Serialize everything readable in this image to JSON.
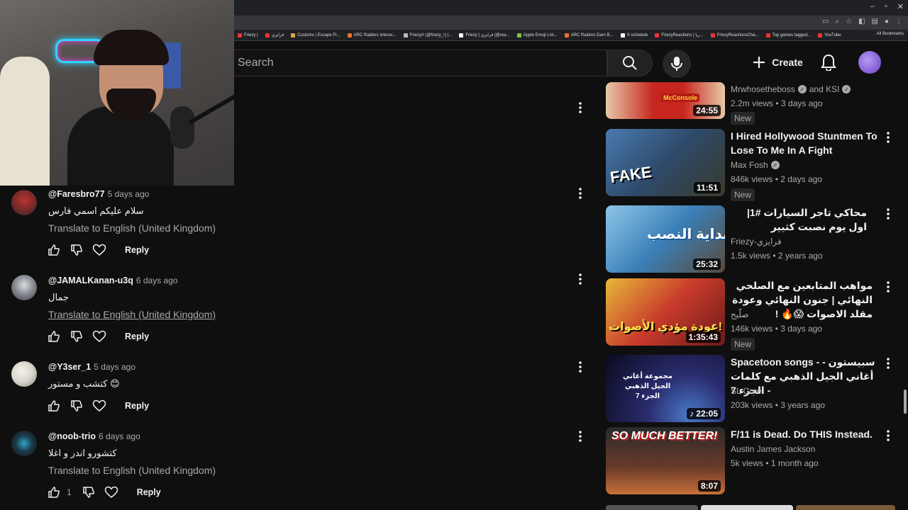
{
  "browser": {
    "bookmarks": [
      {
        "label": "Friezy |",
        "color": "#e33"
      },
      {
        "label": "فرايزي",
        "color": "#e33"
      },
      {
        "label": "Customs | Escape Fr...",
        "color": "#d9a441"
      },
      {
        "label": "ARC Raiders Interac...",
        "color": "#e8742c"
      },
      {
        "label": "Friezy/r (@friezy_r) |...",
        "color": "#bbb"
      },
      {
        "label": "Friezy | فرايزي (@rea...",
        "color": "#fff"
      },
      {
        "label": "Apple Emoji List...",
        "color": "#7cc04a"
      },
      {
        "label": "ARC Raiders Dam B...",
        "color": "#e8742c"
      },
      {
        "label": "X schedule",
        "color": "#fff"
      },
      {
        "label": "FriezyReactions | ريا...",
        "color": "#e33"
      },
      {
        "label": "FriezyReactionsCha...",
        "color": "#e33"
      },
      {
        "label": "Top games tagged...",
        "color": "#e33"
      },
      {
        "label": "YouTube",
        "color": "#e33"
      }
    ],
    "all_bookmarks": "All Bookmarks"
  },
  "header": {
    "search_placeholder": "Search",
    "create_label": "Create"
  },
  "comments": [
    {
      "author": "@Faresbro77",
      "time": "5 days ago",
      "text": "سلام عليكم اسمي فارس",
      "translate": "Translate to English (United Kingdom)",
      "likes": "",
      "reply": "Reply",
      "avatar_color": "#7a2a2a"
    },
    {
      "author": "@JAMALKanan-u3q",
      "time": "6 days ago",
      "text": "جمال",
      "translate": "Translate to English (United Kingdom)",
      "likes": "",
      "reply": "Reply",
      "avatar_color": "#8a8f96"
    },
    {
      "author": "@Y3ser_1",
      "time": "5 days ago",
      "text": "كتشب و مستور 😊",
      "translate": "",
      "likes": "",
      "reply": "Reply",
      "avatar_color": "#d8d4cc"
    },
    {
      "author": "@noob-trio",
      "time": "6 days ago",
      "text": "كتشورو اندر و اغلا",
      "translate": "Translate to English (United Kingdom)",
      "likes": "1",
      "reply": "Reply",
      "avatar_color": "#1d3a4a"
    }
  ],
  "recommendations": [
    {
      "title": "",
      "channel": "Mrwhosetheboss",
      "channel_extra": "and KSI",
      "views": "2.2m views",
      "age": "3 days ago",
      "badge": "New",
      "duration": "24:55",
      "thumb_text": "McConsole",
      "thumb_color": "#c6261e"
    },
    {
      "title": "I Hired Hollywood Stuntmen To Lose To Me In A Fight",
      "channel": "Max Fosh",
      "channel_extra": "",
      "views": "846k views",
      "age": "2 days ago",
      "badge": "New",
      "duration": "11:51",
      "thumb_text": "FAKE",
      "thumb_color": "#2e4a6a"
    },
    {
      "title": "محاكي تاجر السيارات #1| اول يوم نصبت كثيير",
      "channel": "Friezy-فرايزي",
      "channel_extra": "",
      "views": "1.5k views",
      "age": "2 years ago",
      "badge": "",
      "duration": "25:32",
      "thumb_text": "بداية النصب",
      "thumb_color": "#3a7fb8"
    },
    {
      "title": "مواهب المتابعين مع الصلحي النهائي | جنون النهائي وعودة مقلد الاصوات 😱🔥 !",
      "channel": "صلّيح",
      "channel_extra": "",
      "views": "146k views",
      "age": "3 days ago",
      "badge": "New",
      "duration": "1:35:43",
      "thumb_text": "عودة مؤدي الأصوات!",
      "thumb_color": "#c83a2a"
    },
    {
      "title": "Spacetoon songs - سبيستون - أغاني الجيل الذهبي مع كلمات - الجزء 7",
      "channel": "SL Core",
      "channel_extra": "",
      "views": "203k views",
      "age": "3 years ago",
      "badge": "",
      "duration": "22:05",
      "thumb_text": "مجموعة أغاني الجيل الذهبي الجزء 7",
      "thumb_color": "#2a2c6e"
    },
    {
      "title": "F/11 is Dead. Do THIS Instead.",
      "channel": "Austin James Jackson",
      "channel_extra": "",
      "views": "5k views",
      "age": "1 month ago",
      "badge": "",
      "duration": "8:07",
      "thumb_text": "SO MUCH BETTER!",
      "thumb_color": "#6a3a2a"
    }
  ],
  "colors": {
    "background": "#0f0f0f",
    "text_primary": "#f1f1f1",
    "text_secondary": "#aaaaaa",
    "chrome_dark": "#202124"
  }
}
